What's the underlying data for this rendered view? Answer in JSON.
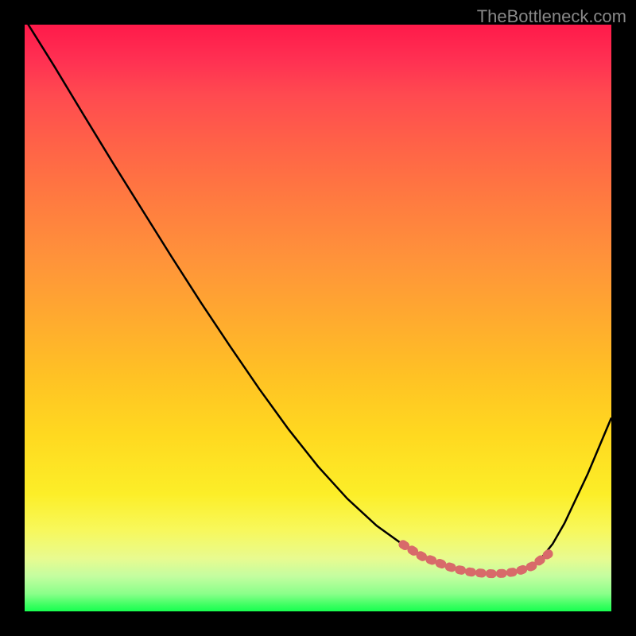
{
  "watermark": "TheBottleneck.com",
  "chart_data": {
    "type": "line",
    "title": "",
    "xlabel": "",
    "ylabel": "",
    "x_range": [
      0,
      1
    ],
    "y_range": [
      0,
      1
    ],
    "series": [
      {
        "name": "bottleneck-curve",
        "x": [
          0.0,
          0.05,
          0.1,
          0.15,
          0.2,
          0.25,
          0.3,
          0.35,
          0.4,
          0.45,
          0.5,
          0.55,
          0.6,
          0.65,
          0.7,
          0.72,
          0.74,
          0.76,
          0.78,
          0.8,
          0.82,
          0.84,
          0.86,
          0.88,
          0.9,
          0.92,
          0.96,
          1.0
        ],
        "y": [
          1.01,
          0.93,
          0.847,
          0.765,
          0.685,
          0.605,
          0.527,
          0.452,
          0.379,
          0.31,
          0.247,
          0.192,
          0.146,
          0.11,
          0.085,
          0.077,
          0.071,
          0.067,
          0.065,
          0.064,
          0.065,
          0.068,
          0.075,
          0.09,
          0.115,
          0.15,
          0.235,
          0.33
        ]
      }
    ],
    "markers": {
      "name": "highlight-segment",
      "x": [
        0.645,
        0.68,
        0.7,
        0.72,
        0.74,
        0.76,
        0.78,
        0.8,
        0.82,
        0.84,
        0.865,
        0.893
      ],
      "y": [
        0.114,
        0.092,
        0.085,
        0.077,
        0.071,
        0.067,
        0.065,
        0.064,
        0.065,
        0.068,
        0.077,
        0.098
      ]
    },
    "gradient_colors": {
      "top": "#ff1a4a",
      "bottom": "#18ff50"
    }
  }
}
